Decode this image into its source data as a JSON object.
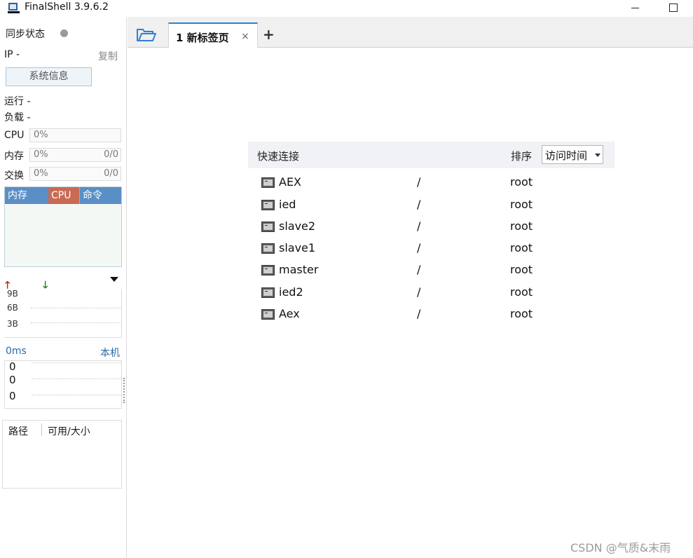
{
  "window": {
    "title": "FinalShell 3.9.6.2"
  },
  "sidebar": {
    "sync_label": "同步状态",
    "ip_label": "IP -",
    "copy_label": "复制",
    "sysinfo_button": "系统信息",
    "run_label": "运行 -",
    "load_label": "负载 -",
    "cpu": {
      "label": "CPU",
      "value": "0%"
    },
    "memory": {
      "label": "内存",
      "value": "0%",
      "ratio": "0/0"
    },
    "swap": {
      "label": "交换",
      "value": "0%",
      "ratio": "0/0"
    },
    "process_table": {
      "headers": [
        "内存",
        "CPU",
        "命令"
      ]
    },
    "network": {
      "ticks": [
        "9B",
        "6B",
        "3B"
      ]
    },
    "latency": {
      "value": "0ms",
      "target": "本机",
      "values": [
        "0",
        "0",
        "0"
      ]
    },
    "file_table": {
      "headers": [
        "路径",
        "可用/大小"
      ]
    }
  },
  "tabs": {
    "active_label": "1 新标签页",
    "close_glyph": "×",
    "add_glyph": "+"
  },
  "quick_connect": {
    "title": "快速连接",
    "sort_label": "排序",
    "sort_value": "访问时间",
    "connections": [
      {
        "name": "AEX",
        "path": "/",
        "user": "root"
      },
      {
        "name": "ied",
        "path": "/",
        "user": "root"
      },
      {
        "name": "slave2",
        "path": "/",
        "user": "root"
      },
      {
        "name": "slave1",
        "path": "/",
        "user": "root"
      },
      {
        "name": "master",
        "path": "/",
        "user": "root"
      },
      {
        "name": "ied2",
        "path": "/",
        "user": "root"
      },
      {
        "name": "Aex",
        "path": "/",
        "user": "root"
      }
    ]
  },
  "watermark": "CSDN @气质&末雨",
  "colors": {
    "accent": "#2f7fd0",
    "process_header": "#5a8fc6",
    "cpu_header": "#c96a55"
  }
}
